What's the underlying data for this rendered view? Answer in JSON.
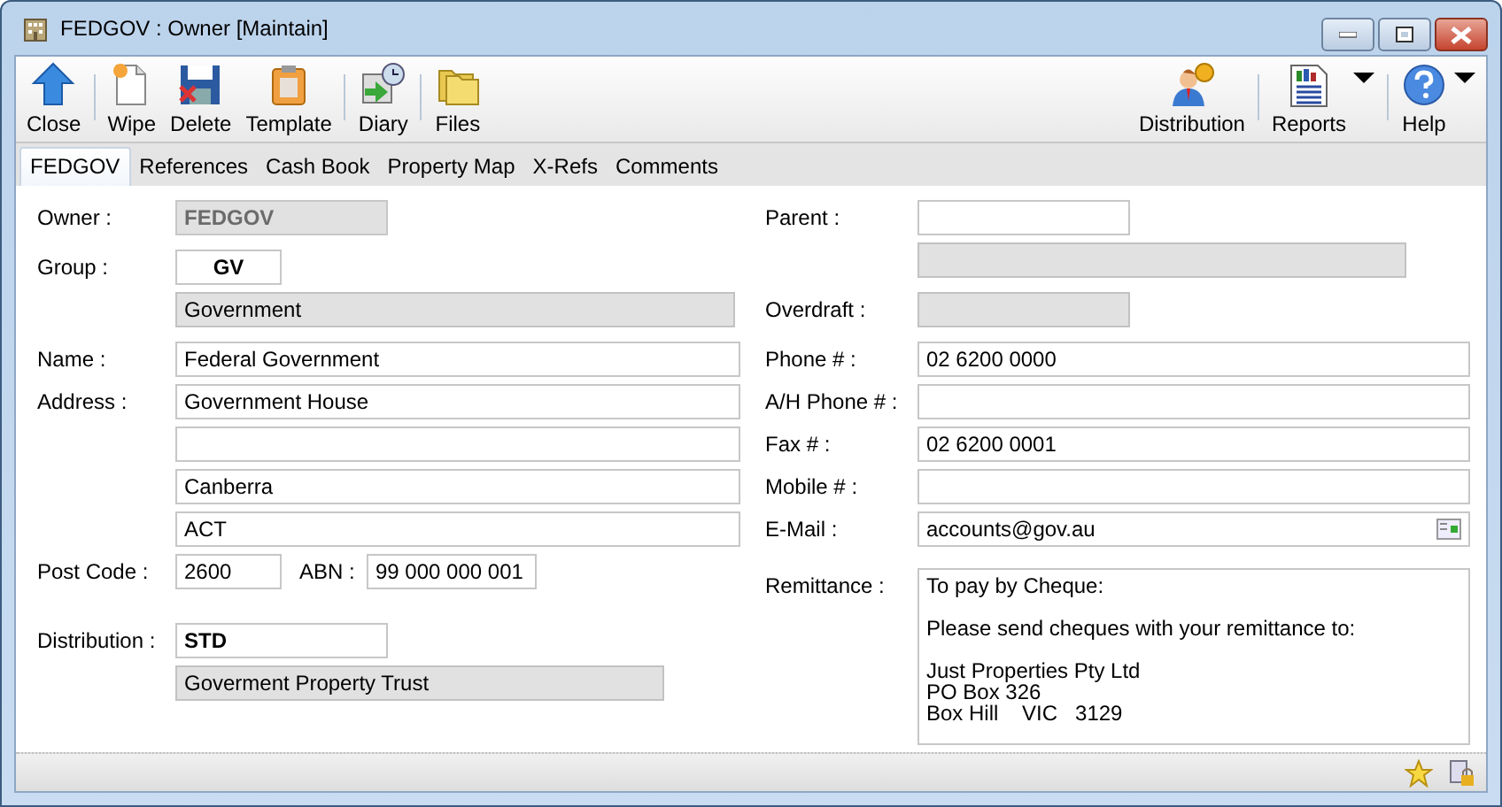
{
  "window": {
    "title": "FEDGOV : Owner [Maintain]"
  },
  "toolbar_left": [
    {
      "buttons": [
        {
          "label": "Close",
          "kind": "close"
        }
      ]
    },
    {
      "buttons": [
        {
          "label": "Wipe",
          "kind": "wipe"
        },
        {
          "label": "Delete",
          "kind": "delete"
        },
        {
          "label": "Template",
          "kind": "template"
        }
      ]
    },
    {
      "buttons": [
        {
          "label": "Diary",
          "kind": "diary"
        }
      ]
    },
    {
      "buttons": [
        {
          "label": "Files",
          "kind": "files"
        }
      ]
    }
  ],
  "toolbar_right": [
    {
      "buttons": [
        {
          "label": "Distribution",
          "kind": "distribution",
          "has_menu": false
        }
      ]
    },
    {
      "buttons": [
        {
          "label": "Reports",
          "kind": "reports",
          "has_menu": true
        }
      ]
    },
    {
      "buttons": [
        {
          "label": "Help",
          "kind": "help",
          "has_menu": true
        }
      ]
    }
  ],
  "tabs": [
    {
      "label": "FEDGOV",
      "selected": true
    },
    {
      "label": "References",
      "selected": false
    },
    {
      "label": "Cash Book",
      "selected": false
    },
    {
      "label": "Property Map",
      "selected": false
    },
    {
      "label": "X-Refs",
      "selected": false
    },
    {
      "label": "Comments",
      "selected": false
    }
  ],
  "left_form": [
    {
      "label": "Owner :",
      "fields": [
        {
          "kind": "locked",
          "value": "FEDGOV"
        }
      ]
    },
    {
      "label": "Group :",
      "fields": [
        {
          "kind": "code",
          "value": "GV"
        }
      ]
    },
    {
      "fields": [
        {
          "kind": "readonly",
          "value": "Government"
        }
      ]
    },
    {
      "label": "Name :",
      "fields": [
        {
          "kind": "text",
          "value": "Federal Government"
        }
      ]
    },
    {
      "label": "Address :",
      "fields": [
        {
          "kind": "text",
          "value": "Government House"
        }
      ]
    },
    {
      "fields": [
        {
          "kind": "text"
        }
      ]
    },
    {
      "fields": [
        {
          "kind": "text",
          "value": "Canberra"
        }
      ]
    },
    {
      "fields": [
        {
          "kind": "text",
          "value": "ACT"
        }
      ]
    },
    {
      "label": "Post Code :",
      "fields": [
        {
          "kind": "text",
          "value": "2600"
        },
        {
          "kind": "label",
          "value": "ABN :"
        },
        {
          "kind": "text",
          "value": "99 000 000 001"
        }
      ]
    },
    {
      "label": "Distribution :",
      "fields": [
        {
          "kind": "code-left",
          "value": "STD"
        }
      ]
    },
    {
      "fields": [
        {
          "kind": "readonly",
          "value": "Goverment Property Trust"
        }
      ]
    }
  ],
  "right_form": [
    {
      "label": "Parent :",
      "fields": [
        {
          "kind": "text"
        }
      ]
    },
    {
      "fields": [
        {
          "kind": "readonly"
        }
      ]
    },
    {
      "label": "Overdraft :",
      "fields": [
        {
          "kind": "readonly"
        }
      ]
    },
    {
      "label": "Phone # :",
      "fields": [
        {
          "kind": "text",
          "value": "02 6200 0000"
        }
      ]
    },
    {
      "label": "A/H Phone # :",
      "fields": [
        {
          "kind": "text"
        }
      ]
    },
    {
      "label": "Fax # :",
      "fields": [
        {
          "kind": "text",
          "value": "02 6200 0001"
        }
      ]
    },
    {
      "label": "Mobile # :",
      "fields": [
        {
          "kind": "text"
        }
      ]
    },
    {
      "label": "E-Mail :",
      "fields": [
        {
          "kind": "email",
          "value": "accounts@gov.au"
        }
      ]
    },
    {
      "label": "Remittance :",
      "fields": [
        {
          "kind": "memo",
          "value": "To pay by Cheque:\n\nPlease send cheques with your remittance to:\n\nJust Properties Pty Ltd\nPO Box 326\nBox Hill    VIC   3129"
        }
      ]
    }
  ]
}
